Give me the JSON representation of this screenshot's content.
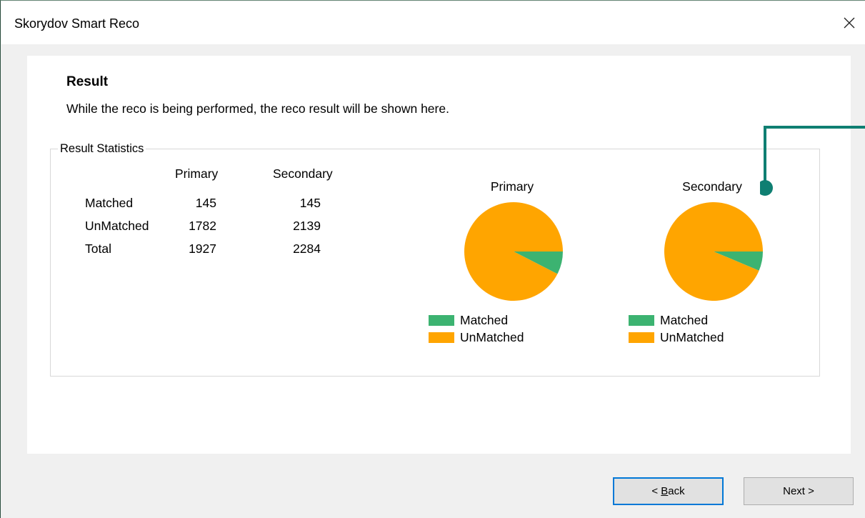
{
  "window": {
    "title": "Skorydov Smart Reco"
  },
  "page": {
    "heading": "Result",
    "description": "While the reco is being performed, the reco result will be shown here."
  },
  "stats": {
    "group_label": "Result Statistics",
    "columns": [
      "Primary",
      "Secondary"
    ],
    "rows": [
      {
        "label": "Matched",
        "primary": "145",
        "secondary": "145"
      },
      {
        "label": "UnMatched",
        "primary": "1782",
        "secondary": "2139"
      },
      {
        "label": "Total",
        "primary": "1927",
        "secondary": "2284"
      }
    ]
  },
  "colors": {
    "matched": "#3cb371",
    "unmatched": "#ffa500",
    "annotation": "#0f7f72",
    "focus": "#0078d7"
  },
  "chart_data": [
    {
      "type": "pie",
      "title": "Primary",
      "categories": [
        "Matched",
        "UnMatched"
      ],
      "values": [
        145,
        1782
      ],
      "legend": "bottom"
    },
    {
      "type": "pie",
      "title": "Secondary",
      "categories": [
        "Matched",
        "UnMatched"
      ],
      "values": [
        145,
        2139
      ],
      "legend": "bottom"
    }
  ],
  "buttons": {
    "back_prefix": "< ",
    "back_mnemonic": "B",
    "back_rest": "ack",
    "next": "Next >"
  },
  "icons": {
    "close": "close-icon"
  }
}
